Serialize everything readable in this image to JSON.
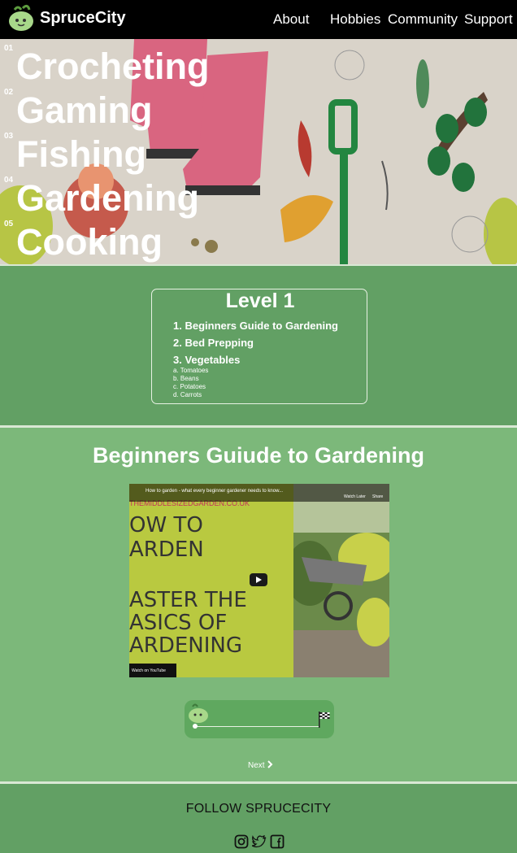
{
  "nav": {
    "brand": "SpruceCity",
    "links": [
      "About",
      "Hobbies",
      "Community",
      "Support"
    ]
  },
  "hero": {
    "hobbies": [
      {
        "num": "01",
        "label": "Crocheting"
      },
      {
        "num": "02",
        "label": "Gaming"
      },
      {
        "num": "03",
        "label": "Fishing"
      },
      {
        "num": "04",
        "label": "Gardening"
      },
      {
        "num": "05",
        "label": "Cooking"
      }
    ]
  },
  "level": {
    "title": "Level 1",
    "lessons": [
      "1. Beginners Guide to Gardening",
      "2. Bed Prepping",
      "3. Vegetables"
    ],
    "sublessons": [
      "a. Tomatoes",
      "b. Beans",
      "c. Potatoes",
      "d. Carrots"
    ]
  },
  "content": {
    "title": "Beginners Guiude to Gardening",
    "video": {
      "caption": "How to garden - what every beginner gardener needs to know...",
      "watch_later": "Watch Later",
      "share": "Share",
      "site": "THEMIDDLESIZEDGARDEN.CO.UK",
      "lines": [
        "OW TO",
        "ARDEN",
        "ASTER THE",
        "ASICS OF",
        "ARDENING"
      ],
      "watch_on": "Watch on YouTube"
    },
    "progress": 0,
    "next_label": "Next"
  },
  "footer": {
    "follow": "FOLLOW SPRUCECITY",
    "social_icons": [
      "instagram-icon",
      "twitter-icon",
      "facebook-icon"
    ]
  }
}
